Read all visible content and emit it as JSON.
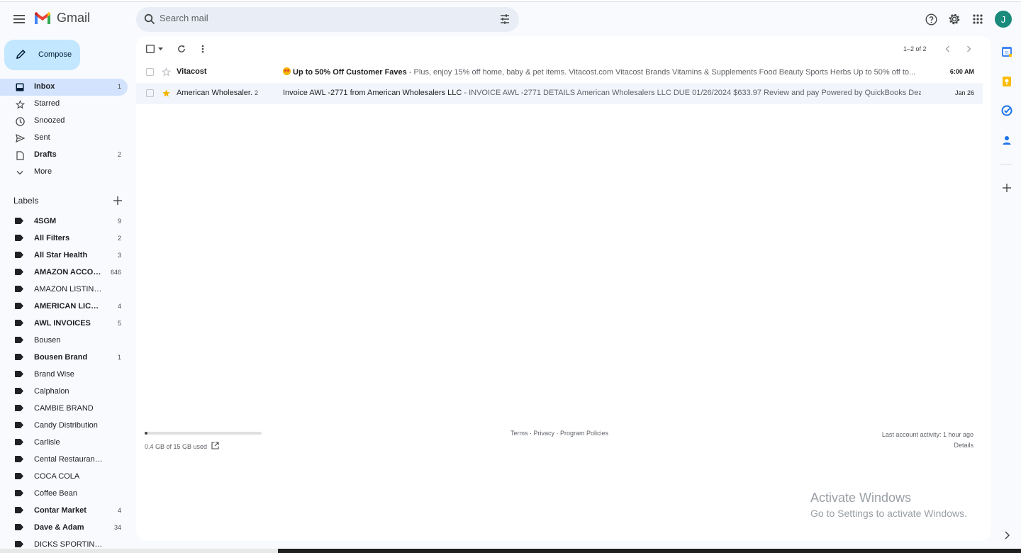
{
  "app": {
    "name": "Gmail"
  },
  "search": {
    "placeholder": "Search mail"
  },
  "header": {
    "avatar_letter": "J"
  },
  "compose": {
    "label": "Compose"
  },
  "nav": [
    {
      "label": "Inbox",
      "count": "1",
      "icon": "inbox-icon",
      "active": true
    },
    {
      "label": "Starred",
      "count": "",
      "icon": "star-icon"
    },
    {
      "label": "Snoozed",
      "count": "",
      "icon": "clock-icon"
    },
    {
      "label": "Sent",
      "count": "",
      "icon": "send-icon"
    },
    {
      "label": "Drafts",
      "count": "2",
      "icon": "draft-icon",
      "bold": true
    },
    {
      "label": "More",
      "count": "",
      "icon": "chevron-down-icon"
    }
  ],
  "labels_section": {
    "title": "Labels"
  },
  "labels": [
    {
      "label": "4SGM",
      "count": "9",
      "bold": true
    },
    {
      "label": "All Filters",
      "count": "2",
      "bold": true
    },
    {
      "label": "All Star Health",
      "count": "3",
      "bold": true
    },
    {
      "label": "AMAZON ACCOU...",
      "count": "646",
      "bold": true
    },
    {
      "label": "AMAZON LISTINGS",
      "count": "",
      "bold": false
    },
    {
      "label": "AMERICAN LICORI...",
      "count": "4",
      "bold": true
    },
    {
      "label": "AWL INVOICES",
      "count": "5",
      "bold": true
    },
    {
      "label": "Bousen",
      "count": "",
      "bold": false
    },
    {
      "label": "Bousen Brand",
      "count": "1",
      "bold": true
    },
    {
      "label": "Brand Wise",
      "count": "",
      "bold": false
    },
    {
      "label": "Calphalon",
      "count": "",
      "bold": false
    },
    {
      "label": "CAMBIE BRAND",
      "count": "",
      "bold": false
    },
    {
      "label": "Candy Distribution",
      "count": "",
      "bold": false
    },
    {
      "label": "Carlisle",
      "count": "",
      "bold": false
    },
    {
      "label": "Cental Restaurant Quot...",
      "count": "",
      "bold": false
    },
    {
      "label": "COCA COLA",
      "count": "",
      "bold": false
    },
    {
      "label": "Coffee Bean",
      "count": "",
      "bold": false
    },
    {
      "label": "Contar Market",
      "count": "4",
      "bold": true
    },
    {
      "label": "Dave & Adam",
      "count": "34",
      "bold": true
    },
    {
      "label": "DICKS SPORTING GOODS",
      "count": "",
      "bold": false
    }
  ],
  "toolbar": {
    "range": "1–2 of 2"
  },
  "emails": [
    {
      "sender": "Vitacost",
      "count": "",
      "subject": "Up to 50% Off Customer Faves",
      "snippet": " - Plus, enjoy 15% off home, baby & pet items.        Vitacost.com Vitacost Brands Vitamins & Supplements Food Beauty Sports Herbs Up to 50% off to...",
      "time": "6:00 AM",
      "unread": true,
      "starred": false
    },
    {
      "sender": "American Wholesaler.",
      "count": "2",
      "subject": "Invoice AWL -2771 from American Wholesalers LLC",
      "snippet": " - INVOICE AWL -2771 DETAILS American Wholesalers LLC DUE 01/26/2024 $633.97 Review and pay Powered by QuickBooks Dear Jesse G...",
      "time": "Jan 26",
      "unread": false,
      "starred": true
    }
  ],
  "storage": {
    "text": "0.4 GB of 15 GB used",
    "used_fraction": 0.027
  },
  "footer": {
    "terms": "Terms",
    "privacy": "Privacy",
    "policies": "Program Policies",
    "sep": " · "
  },
  "activity": {
    "line1": "Last account activity: 1 hour ago",
    "details": "Details"
  },
  "watermark": {
    "line1": "Activate Windows",
    "line2": "Go to Settings to activate Windows."
  },
  "colors": {
    "accent": "#c2e7ff",
    "active_nav": "#d3e3fd",
    "star": "#f4b400",
    "avatar": "#1a8a7c"
  }
}
